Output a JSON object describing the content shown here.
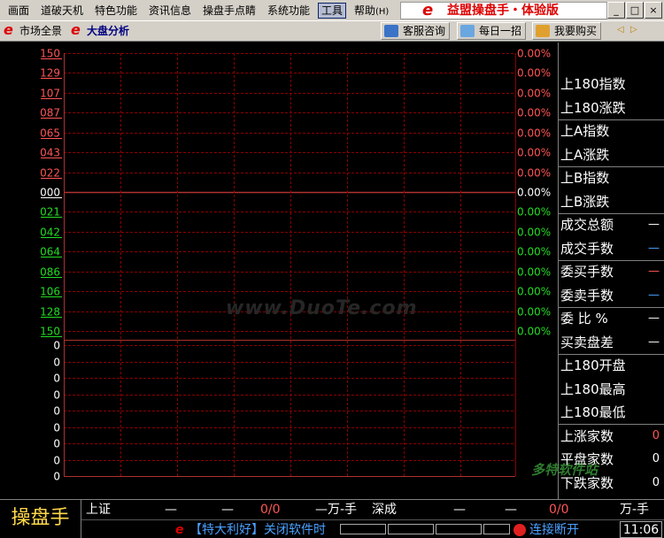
{
  "menu": {
    "items": [
      "画面",
      "道破天机",
      "特色功能",
      "资讯信息",
      "操盘手点睛",
      "系统功能",
      "工具",
      "帮助"
    ],
    "help_hotkey": "(H)",
    "active": "工具",
    "brand_logo": "e",
    "brand_title": "益盟操盘手・体验版",
    "window_buttons": [
      "_",
      "□",
      "×"
    ]
  },
  "toolbar": {
    "tabs": [
      {
        "label": "市场全景",
        "selected": false
      },
      {
        "label": "大盘分析",
        "selected": true
      }
    ],
    "buttons": [
      "客服咨询",
      "每日一招",
      "我要购买"
    ],
    "nav": [
      "◁",
      "▷"
    ]
  },
  "chart": {
    "left_labels": [
      "150",
      "129",
      "107",
      "087",
      "065",
      "043",
      "022",
      "000",
      "021",
      "042",
      "064",
      "086",
      "106",
      "128",
      "150"
    ],
    "left_colors": [
      "red",
      "red",
      "red",
      "red",
      "red",
      "red",
      "red",
      "white",
      "green",
      "green",
      "green",
      "green",
      "green",
      "green",
      "green"
    ],
    "right_labels": [
      "0.00%",
      "0.00%",
      "0.00%",
      "0.00%",
      "0.00%",
      "0.00%",
      "0.00%",
      "0.00%",
      "0.00%",
      "0.00%",
      "0.00%",
      "0.00%",
      "0.00%",
      "0.00%",
      "0.00%"
    ],
    "volume_labels": [
      "0",
      "0",
      "0",
      "0",
      "0",
      "0",
      "0",
      "0",
      "0"
    ],
    "watermark": "www.DuoTe.com",
    "colors": {
      "grid": "#8b0000",
      "up": "#ff5555",
      "down": "#22dd22",
      "neutral": "#ffffff",
      "axis": "#c0c0c0"
    }
  },
  "side_panel": {
    "rows": [
      {
        "label": "上180指数",
        "value": ""
      },
      {
        "label": "上180涨跌",
        "value": ""
      },
      {
        "label": "上A指数",
        "value": ""
      },
      {
        "label": "上A涨跌",
        "value": ""
      },
      {
        "label": "上B指数",
        "value": ""
      },
      {
        "label": "上B涨跌",
        "value": ""
      },
      {
        "label": "成交总额",
        "value": "—"
      },
      {
        "label": "成交手数",
        "value": "—"
      },
      {
        "label": "委买手数",
        "value": "—"
      },
      {
        "label": "委卖手数",
        "value": "—"
      },
      {
        "label": "委 比  %",
        "value": "—"
      },
      {
        "label": "买卖盘差",
        "value": "—"
      },
      {
        "label": "上180开盘",
        "value": ""
      },
      {
        "label": "上180最高",
        "value": ""
      },
      {
        "label": "上180最低",
        "value": ""
      },
      {
        "label": "上涨家数",
        "value": "0"
      },
      {
        "label": "平盘家数",
        "value": "0"
      },
      {
        "label": "下跌家数",
        "value": "0"
      }
    ]
  },
  "bottom": {
    "product_name": "操盘手",
    "sh_label": "上证",
    "sh_dash1": "—",
    "sh_dash2": "—",
    "sh_ratio": "0/0",
    "sh_unit": "—万-手",
    "sz_label": "深成",
    "sz_dash1": "—",
    "sz_dash2": "—",
    "sz_ratio": "0/0",
    "sz_unit": "万-手",
    "promo_logo": "e",
    "promo": "【特大利好】关闭软件时",
    "connection": "连接断开",
    "clock": "11:06"
  },
  "overlay_brand": "多特软件站"
}
